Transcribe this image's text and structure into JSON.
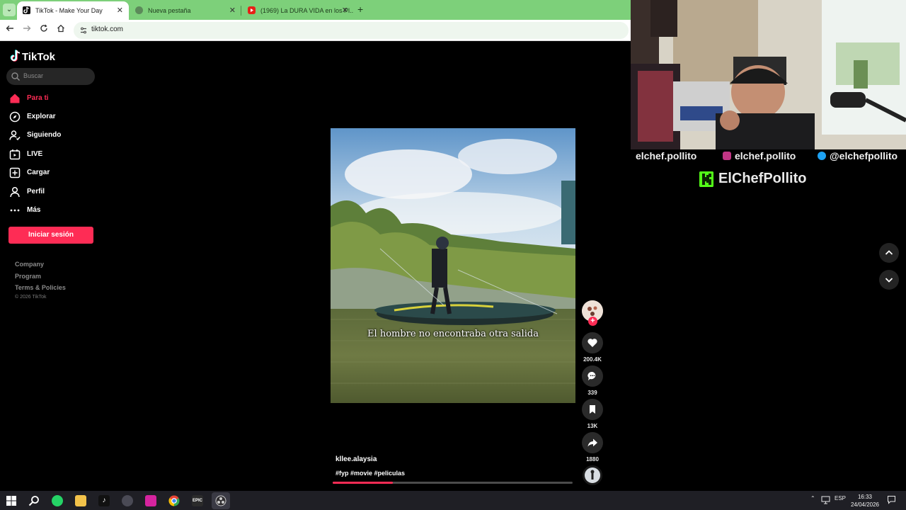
{
  "browser": {
    "tabs": [
      {
        "title": "TikTok - Make Your Day",
        "active": true,
        "icon": "tiktok-favicon"
      },
      {
        "title": "Nueva pestaña",
        "active": false,
        "icon": "chrome-favicon"
      },
      {
        "title": "(1969) La DURA VIDA en los Pl...",
        "active": false,
        "icon": "youtube-favicon"
      }
    ],
    "url": "tiktok.com",
    "theme_color": "#7dd07a"
  },
  "tiktok": {
    "brand": "TikTok",
    "search_placeholder": "Buscar",
    "nav": [
      {
        "label": "Para ti",
        "icon": "home-icon",
        "active": true
      },
      {
        "label": "Explorar",
        "icon": "compass-icon",
        "active": false
      },
      {
        "label": "Siguiendo",
        "icon": "following-icon",
        "active": false
      },
      {
        "label": "LIVE",
        "icon": "live-icon",
        "active": false
      },
      {
        "label": "Cargar",
        "icon": "upload-icon",
        "active": false
      },
      {
        "label": "Perfil",
        "icon": "profile-icon",
        "active": false
      },
      {
        "label": "Más",
        "icon": "more-icon",
        "active": false
      }
    ],
    "login_label": "Iniciar sesión",
    "footer_links": [
      "Company",
      "Program",
      "Terms & Policies"
    ],
    "copyright": "© 2026 TikTok",
    "accent": "#fe2c55"
  },
  "video": {
    "caption": "El hombre no encontraba otra salida",
    "watermark": "",
    "author": "kllee.alaysia",
    "hashtags": "#fyp #movie #peliculas",
    "progress": 0.25,
    "stats": {
      "likes": "200.4K",
      "comments": "339",
      "saves": "13K",
      "shares": "1880"
    }
  },
  "stream_overlay": {
    "socials": [
      {
        "platform": "tiktok",
        "handle": "elchef.pollito"
      },
      {
        "platform": "tiktok-cont",
        "handle": "elchef.pollito"
      },
      {
        "platform": "instagram",
        "handle": "elchef.pollito"
      },
      {
        "platform": "twitter",
        "handle": "@elchefpollito"
      }
    ],
    "kick_name": "ElChefPollito",
    "kick_color": "#53fc18"
  },
  "taskbar": {
    "apps": [
      "start-icon",
      "search-icon",
      "whatsapp-icon",
      "file-explorer-icon",
      "tiktok-icon",
      "app-icon",
      "instagram-icon",
      "chrome-icon",
      "epic-games-icon",
      "obs-icon"
    ],
    "language": "ESP",
    "time": "16:33",
    "date": "24/04/2026"
  }
}
